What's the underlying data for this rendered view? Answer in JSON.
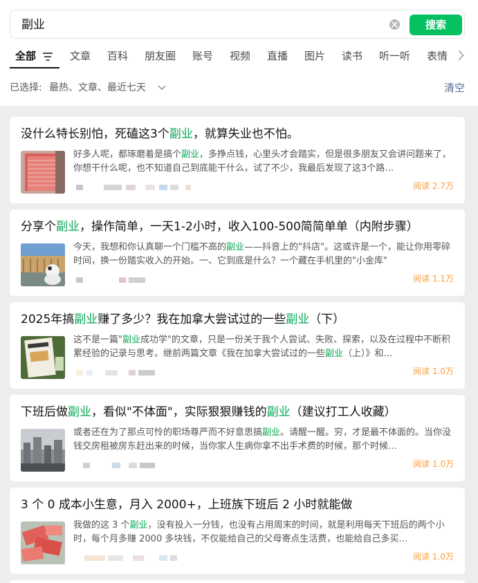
{
  "search": {
    "query": "副业",
    "button_label": "搜索"
  },
  "tabs": [
    {
      "label": "全部",
      "active": true
    },
    {
      "label": "文章"
    },
    {
      "label": "百科"
    },
    {
      "label": "朋友圈"
    },
    {
      "label": "账号"
    },
    {
      "label": "视频"
    },
    {
      "label": "直播"
    },
    {
      "label": "图片"
    },
    {
      "label": "读书"
    },
    {
      "label": "听一听"
    },
    {
      "label": "表情"
    }
  ],
  "filter": {
    "label": "已选择:",
    "value": "最热、文章、最近七天",
    "clear_label": "清空"
  },
  "colors": {
    "accent": "#07c160",
    "highlight": "#07a854",
    "reads": "#fa9d3b",
    "link": "#576b95"
  },
  "results": [
    {
      "title": [
        {
          "t": "没什么特长别怕，死磕这3个"
        },
        {
          "t": "副业",
          "hl": true
        },
        {
          "t": "，就算失业也不怕。"
        }
      ],
      "snippet": [
        {
          "t": "好多人呢，都琢磨着是搞个"
        },
        {
          "t": "副业",
          "hl": true
        },
        {
          "t": "，多挣点钱，心里头才会踏实，但是很多朋友又会讲问题来了，你想干什么呢，也不知道自己到底能干什么，试了不少，我最后发现了这3个路…"
        }
      ],
      "reads": "阅读 2.7万",
      "thumb": "money-stack"
    },
    {
      "title": [
        {
          "t": "分享个"
        },
        {
          "t": "副业",
          "hl": true
        },
        {
          "t": "，操作简单，一天1-2小时，收入100-500简简单单（内附步骤）"
        }
      ],
      "snippet": [
        {
          "t": "今天，我想和你认真聊一个门槛不高的"
        },
        {
          "t": "副业",
          "hl": true
        },
        {
          "t": "——抖音上的\"抖店\"。这或许是一个，能让你用零碎时间，换一份踏实收入的开始。一、它到底是什么？一个藏在手机里的\"小金库\""
        }
      ],
      "reads": "阅读 1.1万",
      "thumb": "building-toy"
    },
    {
      "title": [
        {
          "t": "2025年搞"
        },
        {
          "t": "副业",
          "hl": true
        },
        {
          "t": "赚了多少？我在加拿大尝试过的一些"
        },
        {
          "t": "副业",
          "hl": true
        },
        {
          "t": "（下）"
        }
      ],
      "snippet": [
        {
          "t": "这不是一篇\""
        },
        {
          "t": "副业",
          "hl": true
        },
        {
          "t": "成功学\"的文章，只是一份关于我个人尝试、失败、探索，以及在过程中不断积累经验的记录与思考。继前两篇文章《我在加拿大尝试过的一些"
        },
        {
          "t": "副业",
          "hl": true
        },
        {
          "t": "（上）》和…"
        }
      ],
      "reads": "阅读 1.0万",
      "thumb": "book"
    },
    {
      "title": [
        {
          "t": "下班后做"
        },
        {
          "t": "副业",
          "hl": true
        },
        {
          "t": "，看似\"不体面\"，实际狠狠赚钱的"
        },
        {
          "t": "副业",
          "hl": true
        },
        {
          "t": "（建议打工人收藏）"
        }
      ],
      "snippet": [
        {
          "t": "或者还在为了那点可怜的职场尊严而不好意思搞"
        },
        {
          "t": "副业",
          "hl": true
        },
        {
          "t": "。请醒一醒。穷，才是最不体面的。当你没钱交房租被房东赶出来的时候，当你家人生病你拿不出手术费的时候，那个时候…"
        }
      ],
      "reads": "阅读 1.0万",
      "thumb": "city"
    },
    {
      "title": [
        {
          "t": "3 个 0 成本小生意，月入 2000+，上班族下班后 2 小时就能做"
        }
      ],
      "snippet": [
        {
          "t": "我做的这 3 个"
        },
        {
          "t": "副业",
          "hl": true
        },
        {
          "t": "，没有投入一分钱，也没有占用周末的时间，就是利用每天下班后的两个小时，每个月多赚 2000 多块钱，不仅能给自己的父母寄点生活费，也能给自己多买…"
        }
      ],
      "reads": "阅读 1.0万",
      "thumb": "money-pile"
    }
  ]
}
